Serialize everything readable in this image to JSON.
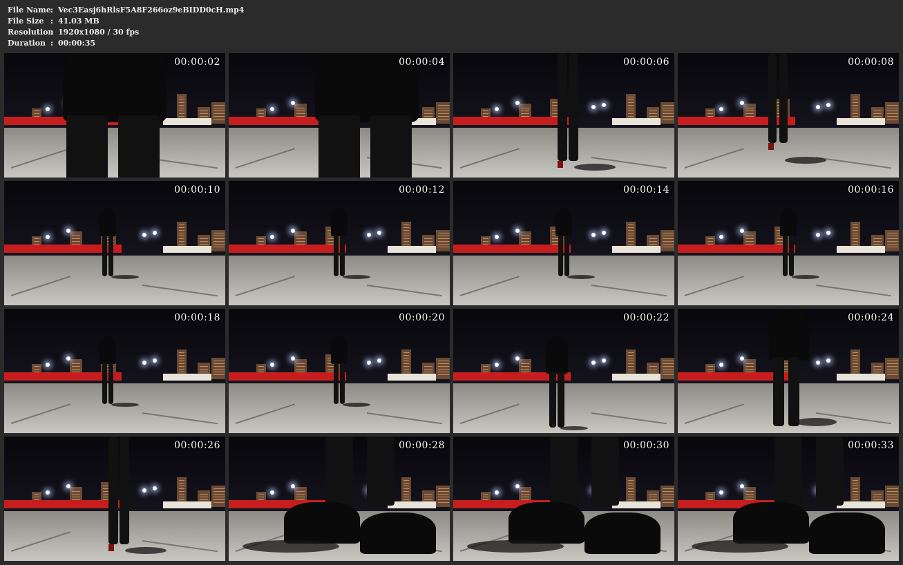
{
  "info": {
    "file_name_label": "File Name",
    "file_name_value": "Vec3Easj6hRlsF5A8F266oz9eBIDD0cH.mp4",
    "file_size_label": "File Size",
    "file_size_value": "41.03 MB",
    "resolution_label": "Resolution",
    "resolution_value": "1920x1080 / 30 fps",
    "duration_label": "Duration",
    "duration_value": "00:00:35",
    "separator": ":"
  },
  "thumbnails": [
    {
      "timestamp": "00:00:02"
    },
    {
      "timestamp": "00:00:04"
    },
    {
      "timestamp": "00:00:06"
    },
    {
      "timestamp": "00:00:08"
    },
    {
      "timestamp": "00:00:10"
    },
    {
      "timestamp": "00:00:12"
    },
    {
      "timestamp": "00:00:14"
    },
    {
      "timestamp": "00:00:16"
    },
    {
      "timestamp": "00:00:18"
    },
    {
      "timestamp": "00:00:20"
    },
    {
      "timestamp": "00:00:22"
    },
    {
      "timestamp": "00:00:24"
    },
    {
      "timestamp": "00:00:26"
    },
    {
      "timestamp": "00:00:28"
    },
    {
      "timestamp": "00:00:30"
    },
    {
      "timestamp": "00:00:33"
    }
  ],
  "colors": {
    "background": "#2b2b2b",
    "text": "#ececec",
    "night_sky": "#0b0b12",
    "store_red": "#c61e1e"
  }
}
